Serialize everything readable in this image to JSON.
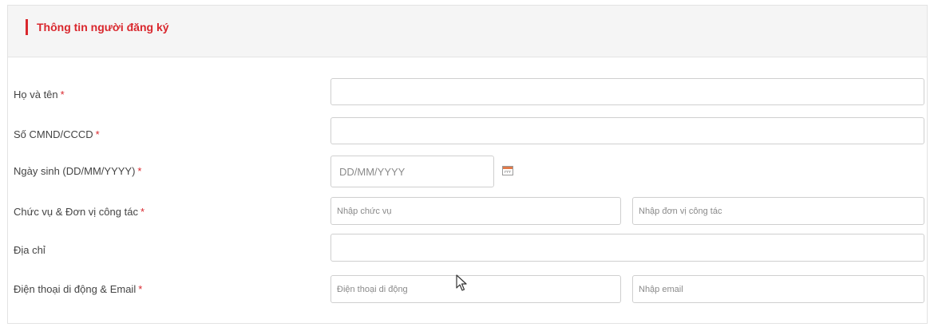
{
  "section": {
    "title": "Thông tin người đăng ký",
    "accent_color": "#d9272d"
  },
  "form": {
    "required_mark": "*",
    "full_name": {
      "label": "Họ và tên",
      "value": "",
      "placeholder": ""
    },
    "id_number": {
      "label": "Số CMND/CCCD",
      "value": "",
      "placeholder": ""
    },
    "birth_date": {
      "label": "Ngày sinh (DD/MM/YYYY)",
      "value": "",
      "placeholder": "DD/MM/YYYY",
      "icon": "calendar-icon"
    },
    "position_org": {
      "label": "Chức vụ & Đơn vị công tác",
      "position_placeholder": "Nhập chức vụ",
      "org_placeholder": "Nhập đơn vị công tác"
    },
    "address": {
      "label": "Địa chỉ",
      "value": "",
      "placeholder": ""
    },
    "phone_email": {
      "label": "Điện thoại di động & Email",
      "phone_placeholder": "Điện thoại di động",
      "email_placeholder": "Nhập email"
    }
  },
  "pointer": {
    "icon": "mouse-pointer-icon"
  }
}
